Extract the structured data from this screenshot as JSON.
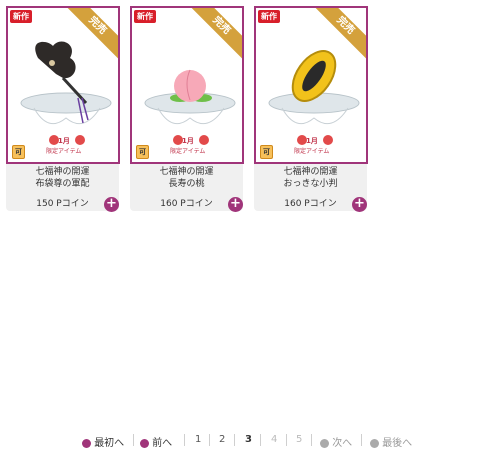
{
  "items": [
    {
      "badge_new": "新作",
      "ribbon": "完売",
      "seasonal": "1月",
      "seasonal_sub": "限定アイテム",
      "gift": "可",
      "line1": "七福神の開運",
      "line2": "布袋尊の軍配",
      "price": "150 Pコイン"
    },
    {
      "badge_new": "新作",
      "ribbon": "完売",
      "seasonal": "1月",
      "seasonal_sub": "限定アイテム",
      "gift": "可",
      "line1": "七福神の開運",
      "line2": "長寿の桃",
      "price": "160 Pコイン"
    },
    {
      "badge_new": "新作",
      "ribbon": "完売",
      "seasonal": "1月",
      "seasonal_sub": "限定アイテム",
      "gift": "可",
      "line1": "七福神の開運",
      "line2": "おっきな小判",
      "price": "160 Pコイン"
    }
  ],
  "pager": {
    "first": "最初へ",
    "prev": "前へ",
    "next": "次へ",
    "last": "最後へ",
    "pages": [
      "1",
      "2",
      "3",
      "4",
      "5"
    ],
    "current": "3"
  },
  "colors": {
    "accent": "#a0357a",
    "new": "#d81f2a",
    "ribbon": "#d4a13c"
  }
}
